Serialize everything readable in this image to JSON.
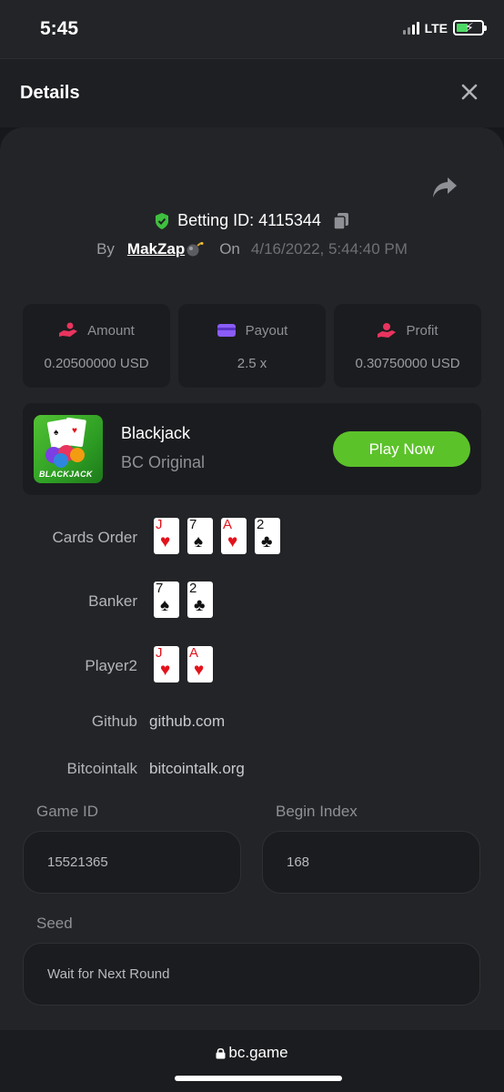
{
  "status_bar": {
    "time": "5:45",
    "network": "LTE"
  },
  "header": {
    "title": "Details"
  },
  "bet": {
    "betting_id_label": "Betting ID: 4115344",
    "by_label": "By",
    "user": "MakZap",
    "on_label": "On",
    "date": "4/16/2022, 5:44:40 PM"
  },
  "stats": [
    {
      "label": "Amount",
      "value": "0.20500000 USD",
      "icon": "hand-coins-icon",
      "color": "#e8345e"
    },
    {
      "label": "Payout",
      "value": "2.5 x",
      "icon": "card-icon",
      "color": "#8b5cf6"
    },
    {
      "label": "Profit",
      "value": "0.30750000 USD",
      "icon": "hand-profit-icon",
      "color": "#e8345e"
    }
  ],
  "game": {
    "thumb_label": "BLACKJACK",
    "name": "Blackjack",
    "provider": "BC Original",
    "play_label": "Play Now"
  },
  "details": {
    "cards_order_label": "Cards Order",
    "cards_order": [
      {
        "rank": "J",
        "suit": "♥",
        "color": "red"
      },
      {
        "rank": "7",
        "suit": "♠",
        "color": "black"
      },
      {
        "rank": "A",
        "suit": "♥",
        "color": "red"
      },
      {
        "rank": "2",
        "suit": "♣",
        "color": "black"
      }
    ],
    "banker_label": "Banker",
    "banker": [
      {
        "rank": "7",
        "suit": "♠",
        "color": "black"
      },
      {
        "rank": "2",
        "suit": "♣",
        "color": "black"
      }
    ],
    "player_label": "Player2",
    "player": [
      {
        "rank": "J",
        "suit": "♥",
        "color": "red"
      },
      {
        "rank": "A",
        "suit": "♥",
        "color": "red"
      }
    ],
    "github_label": "Github",
    "github_value": "github.com",
    "bitcointalk_label": "Bitcointalk",
    "bitcointalk_value": "bitcointalk.org"
  },
  "fields": {
    "game_id_label": "Game ID",
    "game_id_value": "15521365",
    "begin_index_label": "Begin Index",
    "begin_index_value": "168",
    "seed_label": "Seed",
    "seed_value": "Wait for Next Round"
  },
  "browser": {
    "url": "bc.game"
  }
}
